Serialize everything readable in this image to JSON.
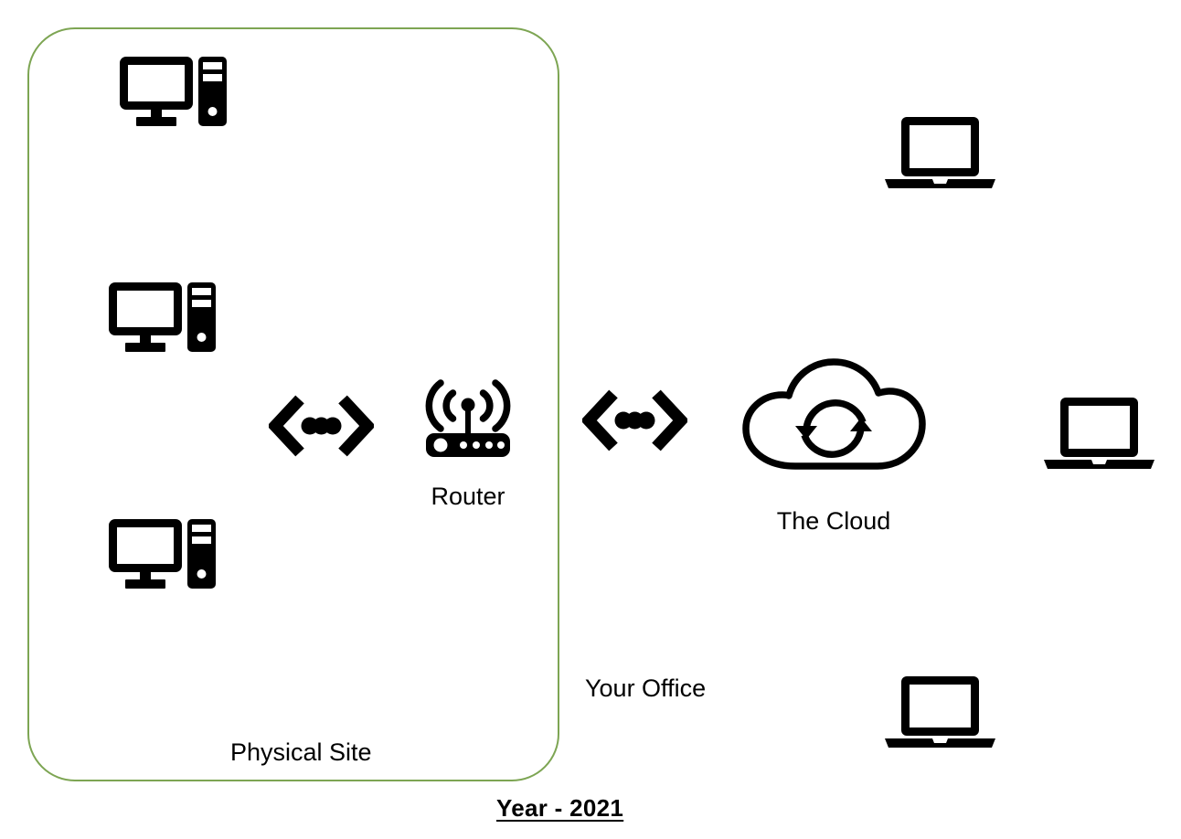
{
  "diagram": {
    "title_label": "Year - 2021",
    "accent_color": "#7DA553",
    "icon_color": "#000000",
    "background_color": "#FFFFFF"
  },
  "site": {
    "boundary_label": "Physical Site",
    "boundary_color": "#7DA553",
    "workstations": [
      {
        "name": "desktop-computer",
        "label": ""
      },
      {
        "name": "desktop-computer",
        "label": ""
      },
      {
        "name": "desktop-computer",
        "label": ""
      }
    ]
  },
  "office": {
    "label": "Your Office"
  },
  "router": {
    "label": "Router",
    "icon": "wifi-router-icon"
  },
  "cloud": {
    "label": "The Cloud",
    "icon": "cloud-sync-icon"
  },
  "connectors": [
    {
      "name": "network-link-left",
      "glyph": "<•••>"
    },
    {
      "name": "network-link-right",
      "glyph": "<•••>"
    }
  ],
  "remote_devices": [
    {
      "name": "laptop-top",
      "label": ""
    },
    {
      "name": "laptop-middle",
      "label": ""
    },
    {
      "name": "laptop-bottom",
      "label": ""
    }
  ]
}
